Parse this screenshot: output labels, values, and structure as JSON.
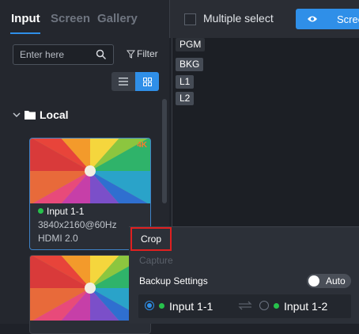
{
  "tabs": [
    "Input",
    "Screen",
    "Gallery"
  ],
  "search": {
    "placeholder": "Enter here"
  },
  "filter_label": "Filter",
  "group_label": "Local",
  "sources": [
    {
      "name": "Input 1-1",
      "resolution": "3840x2160@60Hz",
      "interface": "HDMI 2.0",
      "badge": "4K",
      "status": "online"
    },
    {
      "name": "",
      "resolution": "",
      "interface": ""
    }
  ],
  "toolbar": {
    "multiple_select": "Multiple select",
    "screen_button": "Scree"
  },
  "layers": [
    "PGM",
    "BKG",
    "L1",
    "L2"
  ],
  "context_menu": {
    "crop": "Crop",
    "capture": "Capture",
    "backup_settings": "Backup Settings",
    "auto": "Auto",
    "primary": "Input 1-1",
    "backup": "Input 1-2"
  },
  "colors": {
    "accent": "#2f8fe8",
    "online": "#27c24c",
    "highlight": "#e02020"
  }
}
